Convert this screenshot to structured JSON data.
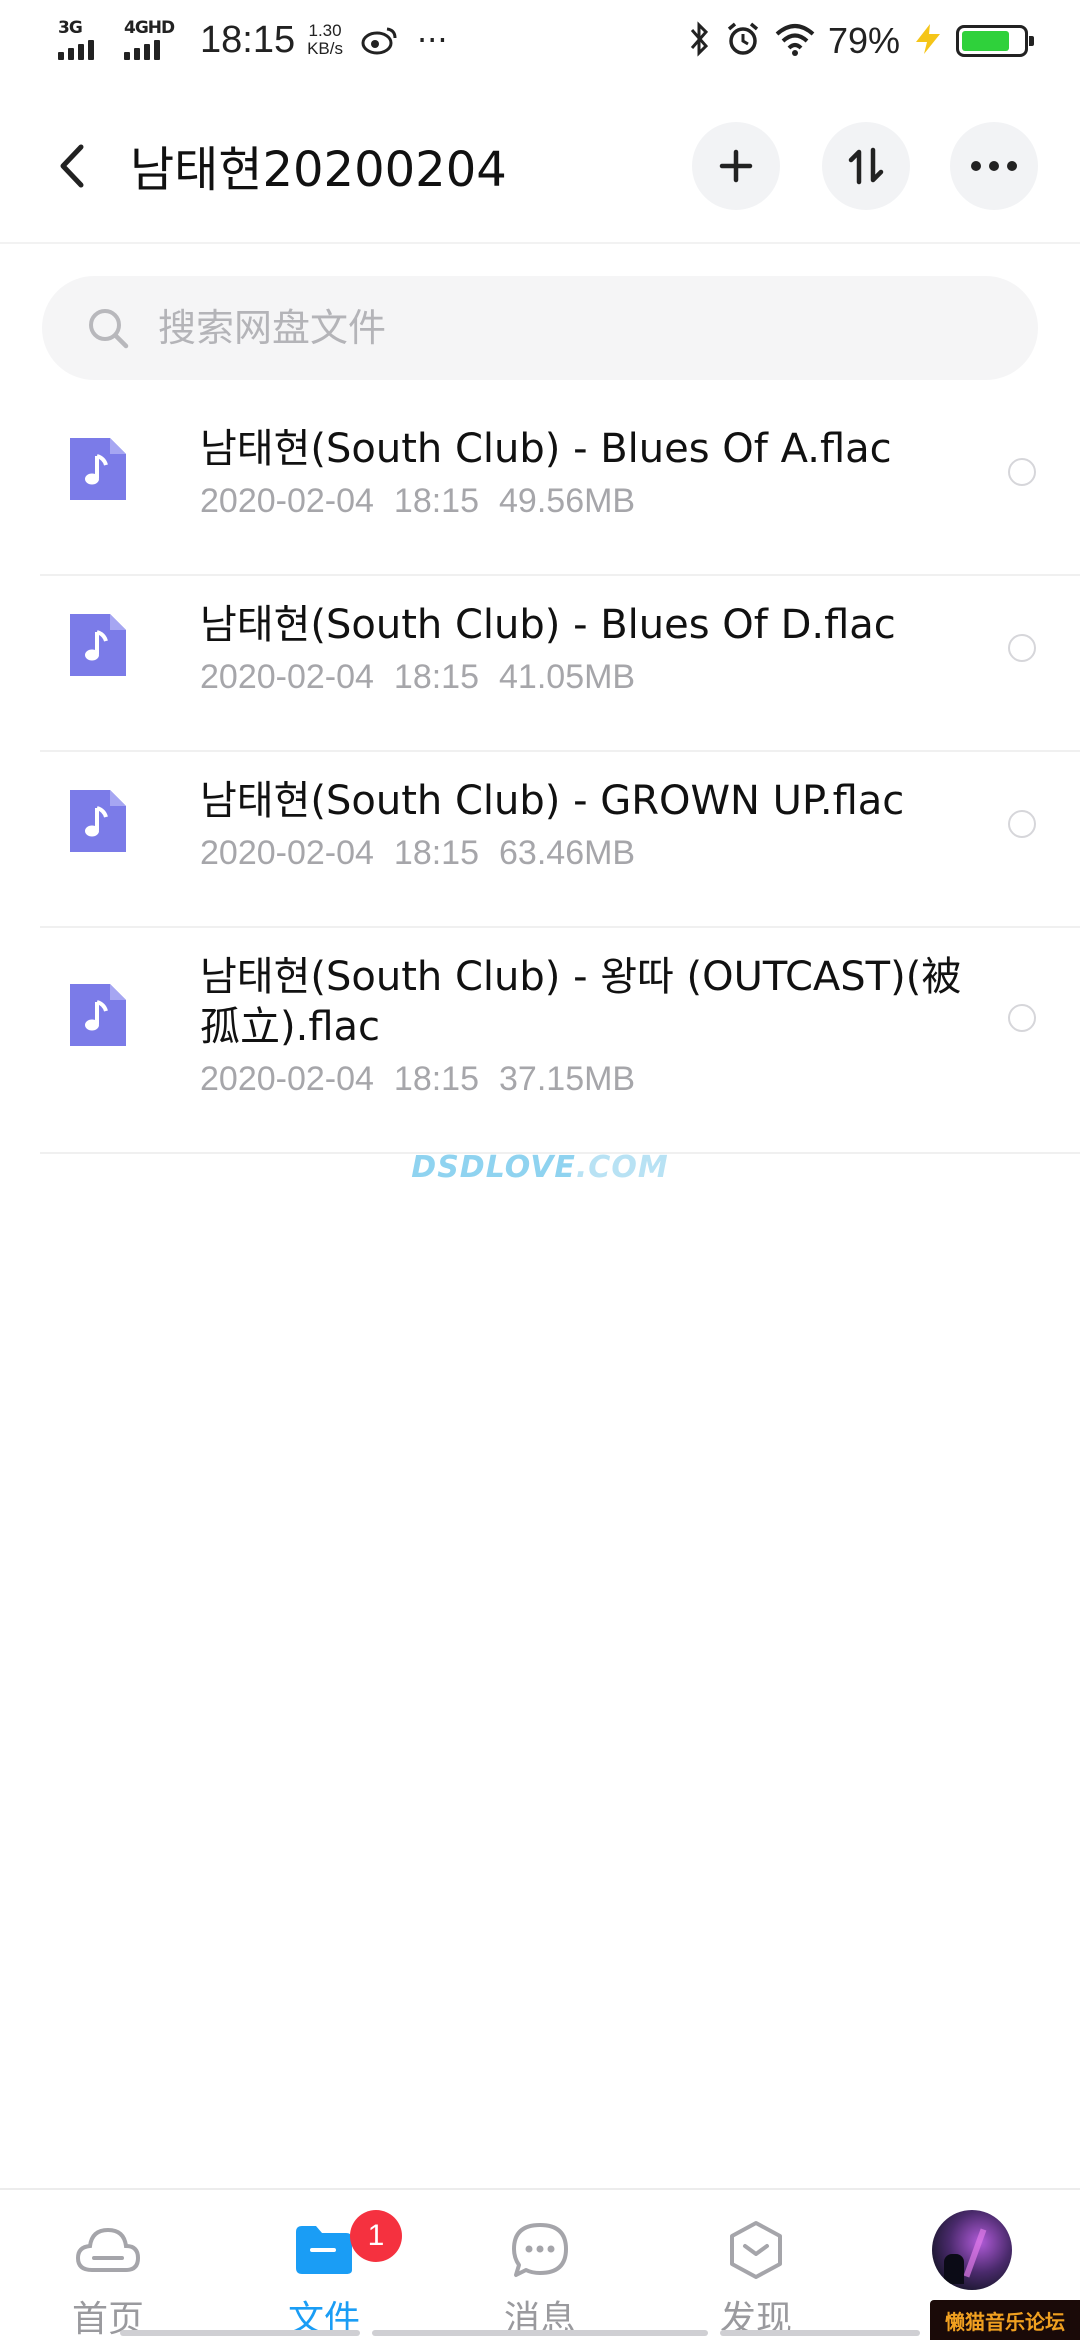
{
  "status_bar": {
    "network1": "3G",
    "network2": "4GHD",
    "time": "18:15",
    "speed_value": "1.30",
    "speed_unit": "KB/s",
    "overflow": "···",
    "battery_percent": "79%",
    "battery_level": 0.79,
    "icons": [
      "weibo-icon",
      "bluetooth-icon",
      "alarm-icon",
      "wifi-icon",
      "charging-icon",
      "battery-icon"
    ]
  },
  "header": {
    "title": "남태현20200204",
    "buttons": [
      "back-icon",
      "add-icon",
      "sort-icon",
      "more-icon"
    ]
  },
  "search": {
    "placeholder": "搜索网盘文件"
  },
  "files": [
    {
      "name": "남태현(South Club) - Blues Of A.flac",
      "date": "2020-02-04",
      "time": "18:15",
      "size": "49.56MB"
    },
    {
      "name": "남태현(South Club) - Blues Of D.flac",
      "date": "2020-02-04",
      "time": "18:15",
      "size": "41.05MB"
    },
    {
      "name": "남태현(South Club) - GROWN UP.flac",
      "date": "2020-02-04",
      "time": "18:15",
      "size": "63.46MB"
    },
    {
      "name": "남태현(South Club) - 왕따 (OUTCAST)(被孤立).flac",
      "date": "2020-02-04",
      "time": "18:15",
      "size": "37.15MB"
    }
  ],
  "watermark": {
    "left": "DSDLOVE",
    "right": ".COM"
  },
  "tabbar": {
    "tabs": [
      {
        "label": "首页",
        "icon": "cloud-icon"
      },
      {
        "label": "文件",
        "icon": "folder-icon"
      },
      {
        "label": "消息",
        "icon": "chat-icon"
      },
      {
        "label": "发现",
        "icon": "discover-icon"
      }
    ],
    "active": "文件",
    "message_badge": "1"
  },
  "corner_tag": "懒猫音乐论坛",
  "colors": {
    "accent": "#1a9df5",
    "file_icon": "#7b7be8",
    "badge": "#f5313f",
    "battery": "#2fd13b"
  }
}
